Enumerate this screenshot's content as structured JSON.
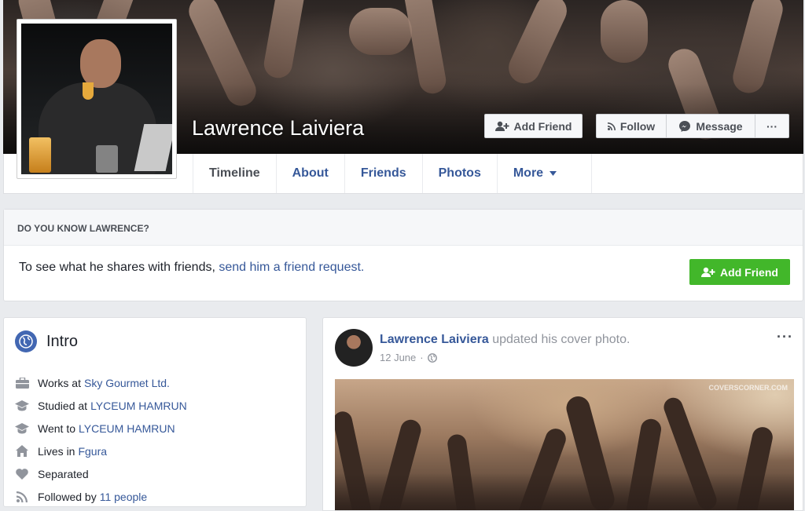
{
  "profile": {
    "name": "Lawrence Laiviera"
  },
  "cover_actions": {
    "add_friend": "Add Friend",
    "follow": "Follow",
    "message": "Message",
    "more": "···"
  },
  "tabs": [
    {
      "label": "Timeline",
      "active": true
    },
    {
      "label": "About"
    },
    {
      "label": "Friends"
    },
    {
      "label": "Photos"
    },
    {
      "label": "More"
    }
  ],
  "know_box": {
    "heading": "DO YOU KNOW LAWRENCE?",
    "text": "To see what he shares with friends, ",
    "link": "send him a friend request.",
    "button": "Add Friend"
  },
  "intro": {
    "title": "Intro",
    "items": [
      {
        "icon": "briefcase-icon",
        "text": "Works at",
        "link": "Sky Gourmet Ltd."
      },
      {
        "icon": "graduation-cap-icon",
        "text": "Studied at",
        "link": "LYCEUM HAMRUN"
      },
      {
        "icon": "graduation-cap-icon",
        "text": "Went to",
        "link": "LYCEUM HAMRUN"
      },
      {
        "icon": "home-icon",
        "text": "Lives in",
        "link": "Fgura"
      },
      {
        "icon": "heart-icon",
        "text": "Separated",
        "link": ""
      },
      {
        "icon": "rss-icon",
        "text": "Followed by",
        "link": "11 people"
      }
    ]
  },
  "post": {
    "author": "Lawrence Laiviera",
    "action": "updated his cover photo.",
    "date": "12 June",
    "separator": "·",
    "more": "···",
    "watermark": "COVERSCORNER.COM"
  },
  "colors": {
    "link": "#365899",
    "green": "#42b72a",
    "background": "#e9ebee"
  }
}
